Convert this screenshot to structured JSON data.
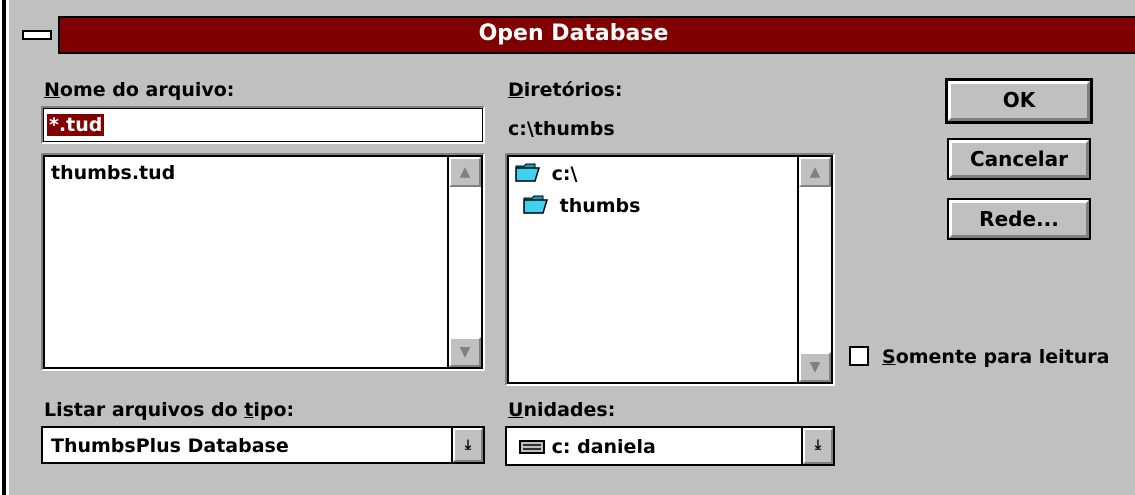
{
  "window": {
    "title": "Open Database"
  },
  "filename": {
    "label_underline": "N",
    "label_rest": "ome do arquivo:",
    "value": "*.tud",
    "files": [
      "thumbs.tud"
    ]
  },
  "directories": {
    "label_underline": "D",
    "label_rest": "iretórios:",
    "current_path": "c:\\thumbs",
    "items": [
      {
        "name": "c:\\",
        "icon": "open-folder-icon"
      },
      {
        "name": "thumbs",
        "icon": "open-folder-icon"
      }
    ]
  },
  "buttons": {
    "ok": "OK",
    "cancel": "Cancelar",
    "network": "Rede..."
  },
  "file_type": {
    "label_before": "Listar arquivos do ",
    "label_underline": "t",
    "label_after": "ipo:",
    "selected": "ThumbsPlus Database"
  },
  "drives": {
    "label_underline": "U",
    "label_rest": "nidades:",
    "selected": "c: daniela"
  },
  "readonly": {
    "label_underline": "S",
    "label_rest": "omente para leitura",
    "checked": false
  },
  "colors": {
    "title_bar": "#800000",
    "selection": "#800000",
    "face": "#c0c0c0"
  }
}
